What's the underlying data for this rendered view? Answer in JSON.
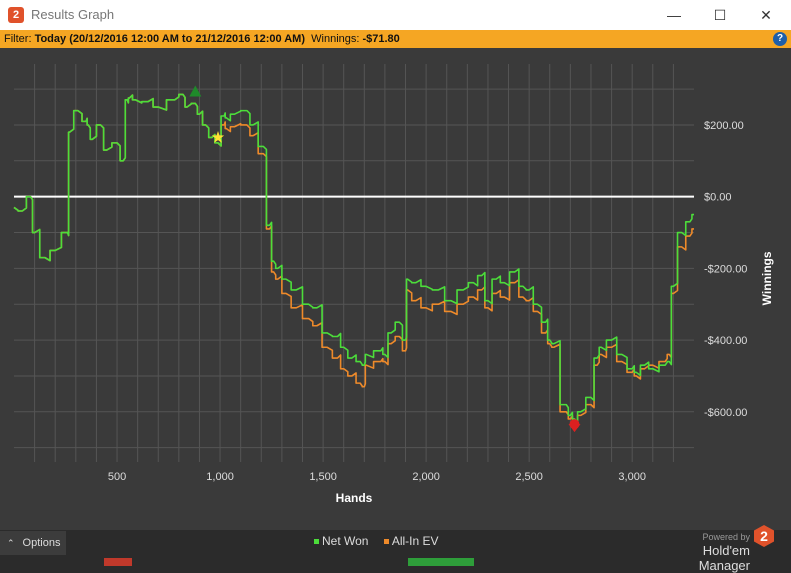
{
  "window": {
    "title": "Results Graph",
    "logo_text": "2",
    "minimize_symbol": "—",
    "maximize_symbol": "☐",
    "close_symbol": "✕"
  },
  "filter": {
    "prefix": "Filter: ",
    "range": "Today (20/12/2016 12:00 AM to 21/12/2016 12:00 AM)",
    "winnings_label": "  Winnings: ",
    "winnings_value": "-$71.80",
    "help_symbol": "?"
  },
  "footer": {
    "options_label": "Options",
    "options_icon": "chevron-up-icon",
    "powered_by": "Powered by",
    "brand": "Hold'em Manager",
    "brand_logo": "2"
  },
  "colors": {
    "net_won": "#4cdd3a",
    "all_in_ev": "#ee8a2a",
    "grid": "#555555",
    "zero_line": "#ffffff",
    "filter_bar": "#f5a623",
    "max_marker": "#1f8a2a",
    "min_marker": "#dd2020",
    "star": "#ffe033"
  },
  "chart_data": {
    "type": "line",
    "xlabel": "Hands",
    "ylabel": "Winnings",
    "xlim": [
      0,
      3300
    ],
    "ylim": [
      -740,
      370
    ],
    "x_ticks": [
      500,
      1000,
      1500,
      2000,
      2500,
      3000
    ],
    "x_tick_labels": [
      "500",
      "1,000",
      "1,500",
      "2,000",
      "2,500",
      "3,000"
    ],
    "y_ticks": [
      200,
      0,
      -200,
      -400,
      -600
    ],
    "y_tick_labels": [
      "$200.00",
      "$0.00",
      "-$200.00",
      "-$400.00",
      "-$600.00"
    ],
    "grid": true,
    "legend_position": "bottom-center",
    "series": [
      {
        "name": "Net Won",
        "x": [
          0,
          40,
          80,
          100,
          150,
          200,
          260,
          270,
          310,
          350,
          360,
          380,
          420,
          450,
          500,
          530,
          550,
          560,
          590,
          650,
          700,
          780,
          820,
          840,
          880,
          900,
          930,
          960,
          990,
          1020,
          1030,
          1070,
          1130,
          1160,
          1210,
          1240,
          1260,
          1280,
          1320,
          1370,
          1430,
          1470,
          1520,
          1570,
          1600,
          1640,
          1680,
          1700,
          1710,
          1780,
          1800,
          1830,
          1870,
          1900,
          1910,
          1950,
          2000,
          2060,
          2120,
          2180,
          2230,
          2270,
          2300,
          2340,
          2380,
          2430,
          2470,
          2500,
          2540,
          2580,
          2600,
          2620,
          2680,
          2700,
          2720,
          2750,
          2800,
          2830,
          2850,
          2900,
          2950,
          3000,
          3020,
          3060,
          3100,
          3160,
          3180,
          3200,
          3240,
          3280,
          3300
        ],
        "y": [
          -30,
          -40,
          0,
          -100,
          -170,
          -150,
          -100,
          180,
          240,
          210,
          200,
          160,
          200,
          130,
          150,
          100,
          270,
          275,
          270,
          265,
          250,
          270,
          285,
          250,
          260,
          230,
          200,
          165,
          150,
          225,
          220,
          230,
          240,
          200,
          140,
          -80,
          -180,
          -200,
          -230,
          -260,
          -300,
          -310,
          -380,
          -390,
          -420,
          -450,
          -460,
          -470,
          -440,
          -430,
          -440,
          -380,
          -350,
          -400,
          -230,
          -240,
          -250,
          -260,
          -290,
          -260,
          -240,
          -220,
          -290,
          -230,
          -240,
          -210,
          -250,
          -260,
          -300,
          -350,
          -400,
          -410,
          -580,
          -610,
          -620,
          -600,
          -560,
          -450,
          -420,
          -400,
          -440,
          -480,
          -490,
          -470,
          -480,
          -470,
          -460,
          -250,
          -100,
          -70,
          -50
        ]
      },
      {
        "name": "All-In EV",
        "x": [
          0,
          40,
          80,
          100,
          150,
          200,
          260,
          270,
          310,
          350,
          360,
          380,
          420,
          450,
          500,
          530,
          550,
          560,
          590,
          650,
          700,
          780,
          820,
          840,
          880,
          900,
          930,
          960,
          990,
          1020,
          1030,
          1070,
          1130,
          1160,
          1210,
          1240,
          1260,
          1280,
          1320,
          1370,
          1430,
          1470,
          1520,
          1570,
          1600,
          1640,
          1680,
          1700,
          1710,
          1780,
          1800,
          1830,
          1870,
          1900,
          1910,
          1950,
          2000,
          2060,
          2120,
          2180,
          2230,
          2270,
          2300,
          2340,
          2380,
          2430,
          2470,
          2500,
          2540,
          2580,
          2600,
          2620,
          2680,
          2700,
          2720,
          2750,
          2800,
          2830,
          2850,
          2900,
          2950,
          3000,
          3020,
          3060,
          3100,
          3160,
          3180,
          3200,
          3240,
          3280,
          3300
        ],
        "y": [
          -30,
          -40,
          0,
          -100,
          -170,
          -150,
          -100,
          180,
          240,
          210,
          200,
          160,
          200,
          130,
          150,
          100,
          270,
          275,
          270,
          265,
          250,
          270,
          285,
          250,
          260,
          230,
          200,
          165,
          150,
          200,
          190,
          195,
          200,
          170,
          120,
          -90,
          -210,
          -230,
          -270,
          -310,
          -340,
          -360,
          -420,
          -450,
          -480,
          -500,
          -520,
          -530,
          -470,
          -460,
          -460,
          -410,
          -390,
          -430,
          -260,
          -290,
          -310,
          -300,
          -320,
          -300,
          -280,
          -260,
          -310,
          -270,
          -280,
          -240,
          -280,
          -290,
          -320,
          -380,
          -410,
          -420,
          -600,
          -620,
          -630,
          -610,
          -580,
          -470,
          -440,
          -420,
          -460,
          -490,
          -500,
          -480,
          -470,
          -460,
          -440,
          -270,
          -140,
          -110,
          -90
        ]
      }
    ],
    "markers": [
      {
        "type": "max",
        "x": 880,
        "y": 285
      },
      {
        "type": "star",
        "x": 990,
        "y": 165
      },
      {
        "type": "min",
        "x": 2720,
        "y": -640
      }
    ]
  }
}
